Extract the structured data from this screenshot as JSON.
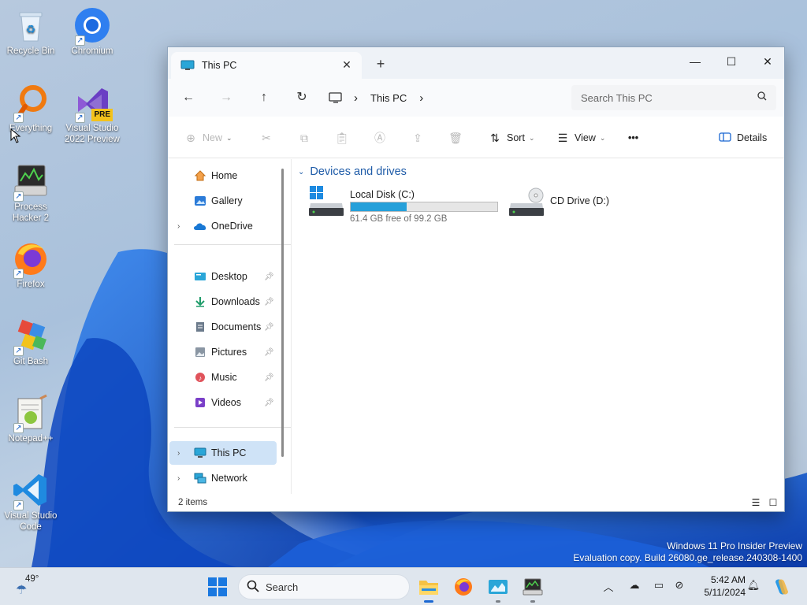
{
  "desktop": {
    "icons": [
      {
        "label": "Recycle Bin"
      },
      {
        "label": "Chromium"
      },
      {
        "label": "Everything"
      },
      {
        "label": "Visual Studio 2022 Preview",
        "badge": "PRE"
      },
      {
        "label": "Process Hacker 2"
      },
      {
        "label": "Firefox"
      },
      {
        "label": "Git Bash"
      },
      {
        "label": "Notepad++"
      },
      {
        "label": "Visual Studio Code"
      }
    ],
    "watermark": {
      "line1": "Windows 11 Pro Insider Preview",
      "line2": "Evaluation copy. Build 26080.ge_release.240308-1400"
    }
  },
  "explorer": {
    "tab_title": "This PC",
    "tab_close": "✕",
    "new_tab": "+",
    "window_controls": {
      "minimize": "—",
      "maximize": "☐",
      "close": "✕"
    },
    "nav": {
      "back": "←",
      "forward": "→",
      "up": "↑",
      "refresh": "↻"
    },
    "address": {
      "crumb": "This PC",
      "sep": "›"
    },
    "search": {
      "placeholder": "Search This PC"
    },
    "commands": {
      "new": "New",
      "sort": "Sort",
      "view": "View",
      "more": "•••",
      "details": "Details"
    },
    "sidebar": {
      "top": [
        {
          "label": "Home",
          "icon": "home-icon"
        },
        {
          "label": "Gallery",
          "icon": "gallery-icon"
        },
        {
          "label": "OneDrive",
          "icon": "onedrive-icon",
          "expandable": true
        }
      ],
      "quick_access": [
        {
          "label": "Desktop",
          "icon": "desktop-folder-icon",
          "pinned": true
        },
        {
          "label": "Downloads",
          "icon": "downloads-icon",
          "pinned": true
        },
        {
          "label": "Documents",
          "icon": "documents-icon",
          "pinned": true
        },
        {
          "label": "Pictures",
          "icon": "pictures-icon",
          "pinned": true
        },
        {
          "label": "Music",
          "icon": "music-icon",
          "pinned": true
        },
        {
          "label": "Videos",
          "icon": "videos-icon",
          "pinned": true
        }
      ],
      "locations": [
        {
          "label": "This PC",
          "icon": "this-pc-icon",
          "selected": true
        },
        {
          "label": "Network",
          "icon": "network-icon"
        }
      ]
    },
    "main": {
      "group_title": "Devices and drives",
      "drives": [
        {
          "name": "Local Disk (C:)",
          "free_text": "61.4 GB free of 99.2 GB",
          "used_fraction": 0.381
        },
        {
          "name": "CD Drive (D:)"
        }
      ]
    },
    "status": {
      "item_count": "2 items"
    }
  },
  "taskbar": {
    "weather_temp": "49°",
    "search_label": "Search",
    "time": "5:42 AM",
    "date": "5/11/2024"
  },
  "colors": {
    "accent": "#1a67d2",
    "drive_bar": "#26a0da",
    "selected": "#cfe3f7",
    "group_header": "#1f5ca8"
  }
}
